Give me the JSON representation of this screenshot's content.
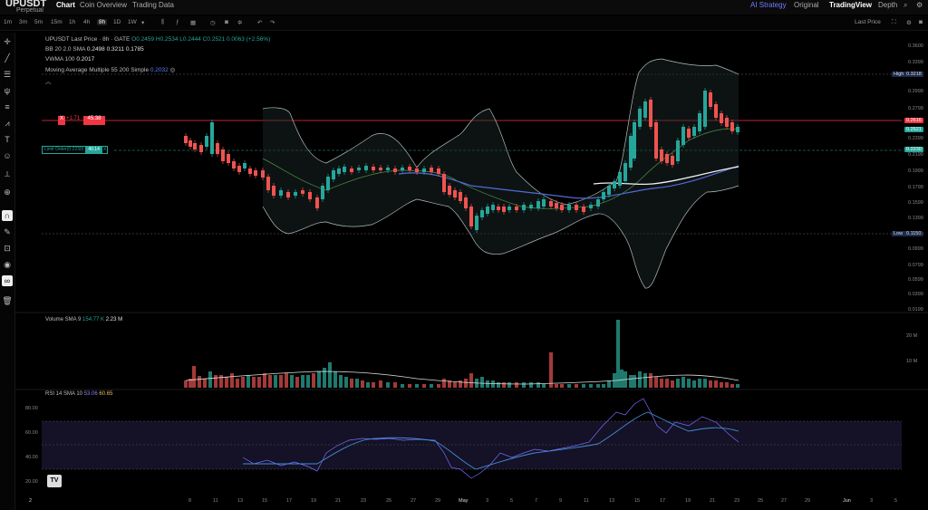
{
  "header": {
    "symbol": "UPUSDT",
    "symbol_type": "Perpetual",
    "nav_tabs": [
      "Chart",
      "Coin Overview",
      "Trading Data"
    ],
    "right_nav": {
      "ai": "AI Strategy",
      "original": "Original",
      "tradingview": "TradingView",
      "depth": "Depth"
    }
  },
  "toolbar": {
    "timeframes": [
      "1m",
      "3m",
      "5m",
      "15m",
      "1h",
      "4h",
      "8h",
      "1D",
      "1W"
    ],
    "active_timeframe": "8h",
    "price_mode": "Last Price"
  },
  "legend": {
    "main": {
      "pair": "UPUSDT Last Price",
      "interval": "8h",
      "exchange": "GATE",
      "o": "O0.2459",
      "h": "H0.2534",
      "l": "L0.2444",
      "c": "C0.2521",
      "chg": "0.0063 (+2.56%)"
    },
    "bb": {
      "label": "BB 20 2.0 SMA",
      "v1": "0.2498",
      "v2": "0.3211",
      "v3": "0.1785"
    },
    "vwma": {
      "label": "VWMA 100",
      "v": "0.2017"
    },
    "ma": {
      "label": "Moving Average Multiple 55 200 Simple",
      "v": "0.2032"
    }
  },
  "flag": {
    "x": "X",
    "delta": "+1.71",
    "value": "45.38"
  },
  "limit_order": {
    "label": "Limit Order(0.2230)",
    "qty": "40.14",
    "close": "X"
  },
  "price_axis": [
    "0.3600",
    "0.3399",
    "0.2999",
    "0.2799",
    "0.2399",
    "0.2199",
    "0.1999",
    "0.1799",
    "0.1599",
    "0.1399",
    "0.1200",
    "0.0999",
    "0.0799",
    "0.0599",
    "0.0399",
    "0.0199"
  ],
  "price_tags": {
    "high_label": "High",
    "high": "0.3218",
    "low_label": "Low",
    "low": "0.1150",
    "current_red": "0.2616",
    "current_green": "0.2521",
    "limit": "0.2230"
  },
  "date_axis": [
    "8",
    "11",
    "13",
    "15",
    "17",
    "19",
    "21",
    "23",
    "25",
    "27",
    "29",
    "May",
    "3",
    "5",
    "7",
    "9",
    "11",
    "13",
    "15",
    "17",
    "19",
    "21",
    "23",
    "25",
    "27",
    "29",
    "Jun",
    "3",
    "5"
  ],
  "volume": {
    "label": "Volume SMA 9",
    "v1": "154.77 K",
    "v2": "2.23 M",
    "axis": [
      "20 M",
      "10 M"
    ]
  },
  "rsi": {
    "label": "RSI 14 SMA 10",
    "v1": "53.06",
    "v2": "60.65",
    "axis": [
      "80.00",
      "60.00",
      "40.00",
      "20.00"
    ]
  },
  "logo": "TV",
  "bottom_num": "2",
  "colors": {
    "bg": "#000000",
    "up": "#26a69a",
    "down": "#ef5350",
    "accent": "#5c7cfa",
    "ai": "#6f7cff"
  }
}
